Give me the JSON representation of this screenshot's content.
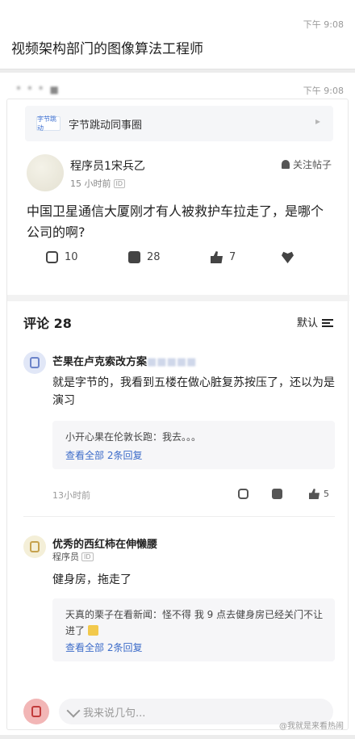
{
  "message1": {
    "time": "下午 9:08",
    "text": "视频架构部门的图像算法工程师"
  },
  "message2": {
    "time": "下午 9:08",
    "sender_blurred": "* * * ■",
    "circle": {
      "logo": "字节跳动",
      "label": "字节跳动同事圈",
      "arrow": "▸"
    },
    "post": {
      "username": "程序员1宋兵乙",
      "posted": "15 小时前",
      "id_tag": "ID",
      "follow_label": "关注帖子",
      "content": "中国卫星通信大厦刚才有人被救护车拉走了，是哪个公司的啊?",
      "repost_count": "10",
      "comment_count": "28",
      "like_count": "7"
    },
    "comments_header": {
      "title": "评论 28",
      "sort": "默认"
    },
    "comments": [
      {
        "name": "芒果在卢克索改方案",
        "name_tail": "■■■■■",
        "text": "就是字节的，我看到五楼在做心脏复苏按压了，还以为是演习",
        "reply_preview": "小开心果在伦敦长跑：我去。。。",
        "reply_more": "查看全部 2条回复",
        "time": "13小时前",
        "like_count": "5"
      },
      {
        "name": "优秀的西红柿在伸懒腰",
        "role": "程序员",
        "id_tag": "ID",
        "text": "健身房，拖走了",
        "reply_preview": "天真的栗子在看新闻：怪不得 我 9 点去健身房已经关门不让进了",
        "reply_more": "查看全部 2条回复"
      }
    ],
    "input_placeholder": "我来说几句..."
  },
  "watermark": "@我就是来看热闹"
}
